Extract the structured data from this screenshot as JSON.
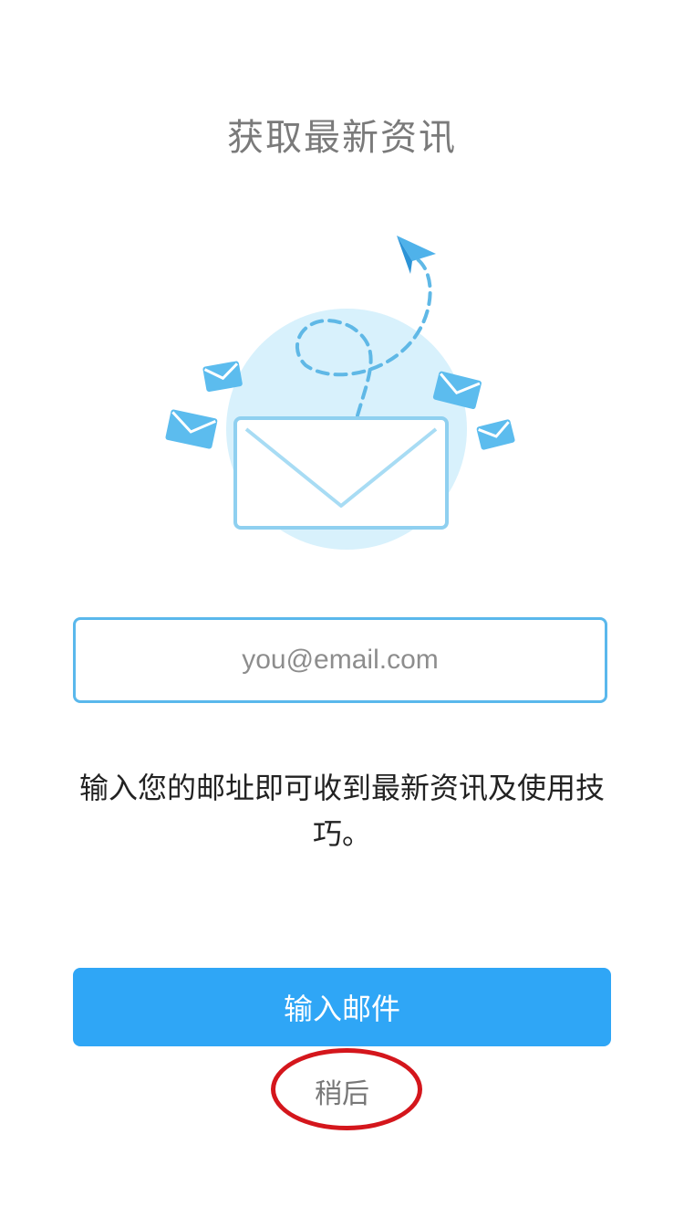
{
  "header": {
    "title": "获取最新资讯"
  },
  "illustration": {
    "icon": "mail-plane-illustration",
    "colors": {
      "circle": "#d8f1fc",
      "envelope_border": "#8fd0f0",
      "small_envelope": "#5cbcee",
      "dash": "#5fb8e6",
      "plane": "#4fb2ea"
    }
  },
  "email": {
    "placeholder": "you@email.com",
    "value": "",
    "border_color": "#5ab8ec"
  },
  "description": "输入您的邮址即可收到最新资讯及使用技巧。",
  "actions": {
    "primary_label": "输入邮件",
    "primary_color": "#2fa6f6",
    "later_label": "稍后",
    "highlight_color": "#d4161c"
  }
}
